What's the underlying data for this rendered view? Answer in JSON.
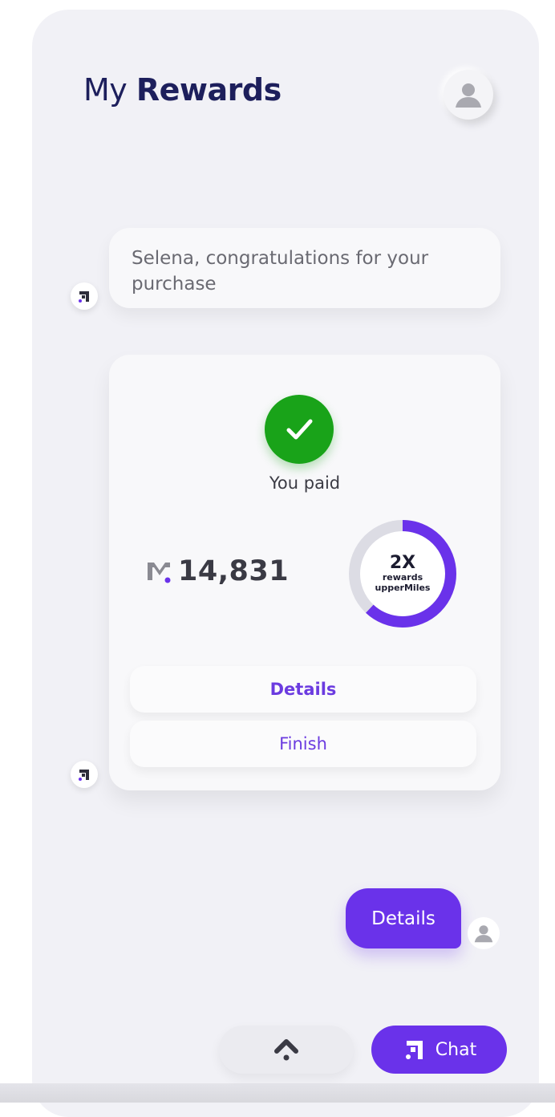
{
  "header": {
    "title_light": "My",
    "title_bold": "Rewards"
  },
  "icons": {
    "profile": "user-icon",
    "bot": "upper-logo-icon",
    "paid": "check-icon",
    "miles": "miles-logo-icon",
    "scroll_top": "chevron-up-icon"
  },
  "conversation": {
    "bot_message": "Selena, congratulations for your purchase",
    "payment_card": {
      "status": "You paid",
      "miles_amount": "14,831",
      "badge_multiplier": "2X",
      "badge_line1": "rewards",
      "badge_line2": "upperMiles",
      "badge_progress_percent": 62,
      "details_label": "Details",
      "finish_label": "Finish"
    },
    "user_reply": "Details"
  },
  "bottom_bar": {
    "chat_label": "Chat"
  },
  "colors": {
    "accent": "#6a32ea",
    "success": "#19a319",
    "title": "#1d1f5c",
    "ring_track": "#dcdce4"
  }
}
